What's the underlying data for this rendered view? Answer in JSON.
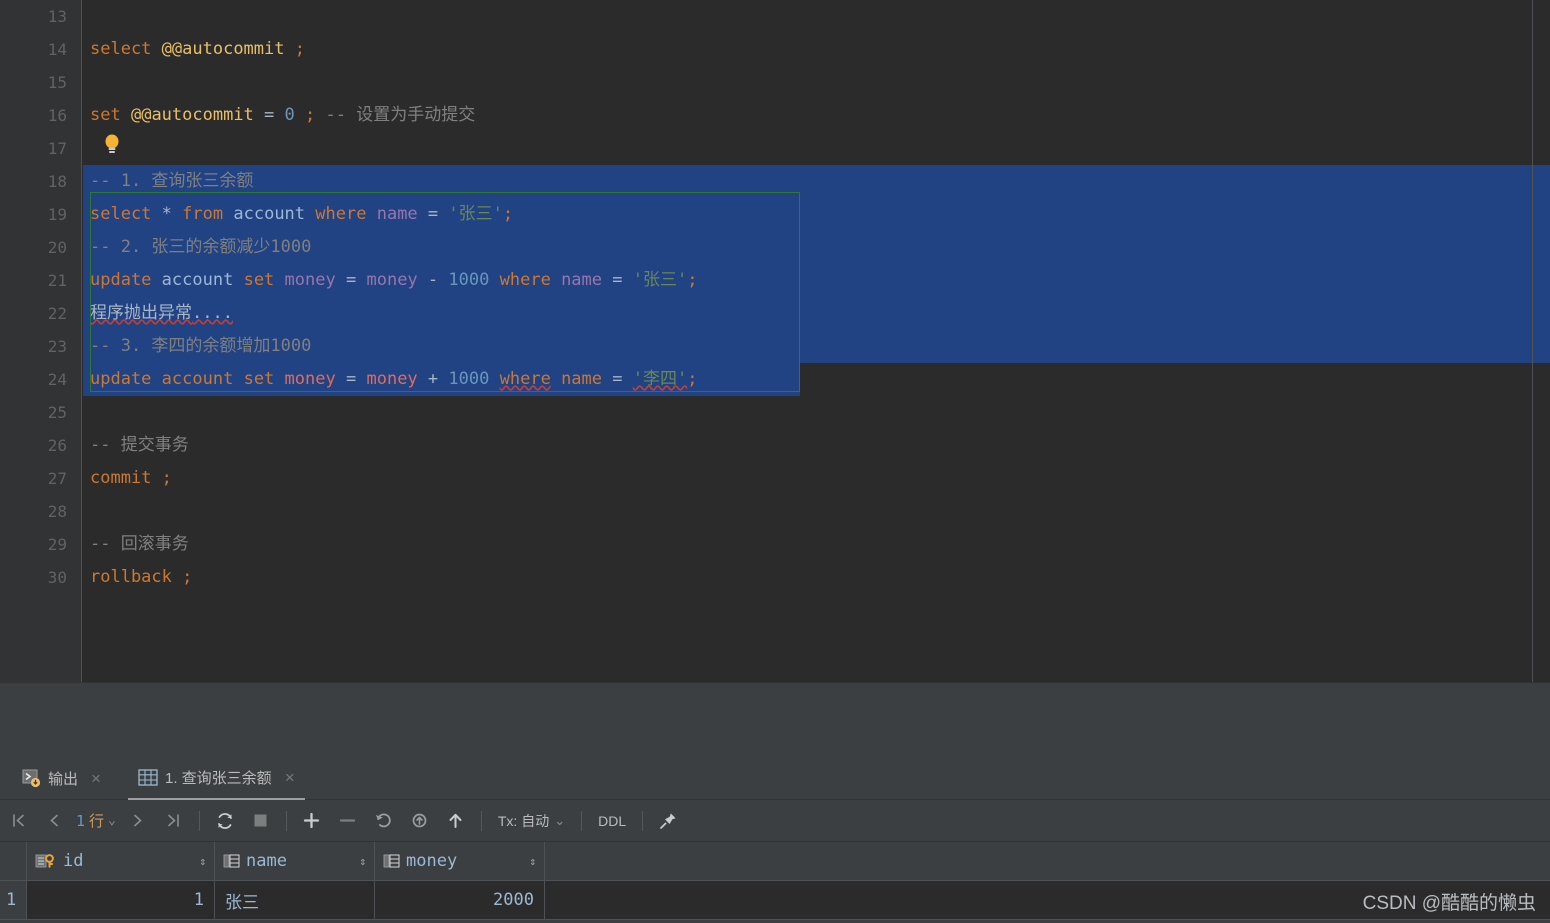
{
  "editor": {
    "first_line_number": 13,
    "lines": [
      {
        "num": 13,
        "selected": false,
        "tokens": []
      },
      {
        "num": 14,
        "selected": false,
        "tokens": [
          {
            "t": "select",
            "c": "kw"
          },
          {
            "t": " ",
            "c": "plain"
          },
          {
            "t": "@@autocommit",
            "c": "var"
          },
          {
            "t": " ",
            "c": "plain"
          },
          {
            "t": ";",
            "c": "kw"
          }
        ]
      },
      {
        "num": 15,
        "selected": false,
        "tokens": []
      },
      {
        "num": 16,
        "selected": false,
        "tokens": [
          {
            "t": "set",
            "c": "kw"
          },
          {
            "t": " ",
            "c": "plain"
          },
          {
            "t": "@@autocommit",
            "c": "var"
          },
          {
            "t": " ",
            "c": "plain"
          },
          {
            "t": "=",
            "c": "op"
          },
          {
            "t": " ",
            "c": "plain"
          },
          {
            "t": "0",
            "c": "num"
          },
          {
            "t": " ",
            "c": "plain"
          },
          {
            "t": ";",
            "c": "kw"
          },
          {
            "t": " ",
            "c": "plain"
          },
          {
            "t": "-- 设置为手动提交",
            "c": "cmt"
          }
        ]
      },
      {
        "num": 17,
        "selected": false,
        "tokens": []
      },
      {
        "num": 18,
        "selected": true,
        "tokens": [
          {
            "t": "-- 1. 查询张三余额",
            "c": "cmt"
          }
        ]
      },
      {
        "num": 19,
        "selected": true,
        "tokens": [
          {
            "t": "select",
            "c": "kw"
          },
          {
            "t": " ",
            "c": "plain"
          },
          {
            "t": "*",
            "c": "op"
          },
          {
            "t": " ",
            "c": "plain"
          },
          {
            "t": "from",
            "c": "kw"
          },
          {
            "t": " ",
            "c": "plain"
          },
          {
            "t": "account",
            "c": "tbl"
          },
          {
            "t": " ",
            "c": "plain"
          },
          {
            "t": "where",
            "c": "kw"
          },
          {
            "t": " ",
            "c": "plain"
          },
          {
            "t": "name",
            "c": "col"
          },
          {
            "t": " ",
            "c": "plain"
          },
          {
            "t": "=",
            "c": "op"
          },
          {
            "t": " ",
            "c": "plain"
          },
          {
            "t": "'张三'",
            "c": "str"
          },
          {
            "t": ";",
            "c": "kw"
          }
        ]
      },
      {
        "num": 20,
        "selected": true,
        "tokens": [
          {
            "t": "-- 2. 张三的余额减少1000",
            "c": "cmt"
          }
        ]
      },
      {
        "num": 21,
        "selected": true,
        "tokens": [
          {
            "t": "update",
            "c": "kw"
          },
          {
            "t": " ",
            "c": "plain"
          },
          {
            "t": "account",
            "c": "tbl"
          },
          {
            "t": " ",
            "c": "plain"
          },
          {
            "t": "set",
            "c": "kw"
          },
          {
            "t": " ",
            "c": "plain"
          },
          {
            "t": "money",
            "c": "col"
          },
          {
            "t": " ",
            "c": "plain"
          },
          {
            "t": "=",
            "c": "op"
          },
          {
            "t": " ",
            "c": "plain"
          },
          {
            "t": "money",
            "c": "col"
          },
          {
            "t": " ",
            "c": "plain"
          },
          {
            "t": "-",
            "c": "op"
          },
          {
            "t": " ",
            "c": "plain"
          },
          {
            "t": "1000",
            "c": "num"
          },
          {
            "t": " ",
            "c": "plain"
          },
          {
            "t": "where",
            "c": "kw"
          },
          {
            "t": " ",
            "c": "plain"
          },
          {
            "t": "name",
            "c": "col"
          },
          {
            "t": " ",
            "c": "plain"
          },
          {
            "t": "=",
            "c": "op"
          },
          {
            "t": " ",
            "c": "plain"
          },
          {
            "t": "'张三'",
            "c": "str"
          },
          {
            "t": ";",
            "c": "kw"
          }
        ]
      },
      {
        "num": 22,
        "selected": true,
        "tokens": [
          {
            "t": "程序抛出异常",
            "c": "plain sq"
          },
          {
            "t": "....",
            "c": "plain sq"
          }
        ]
      },
      {
        "num": 23,
        "selected": true,
        "tokens": [
          {
            "t": "-- 3. 李四的余额增加1000",
            "c": "cmt"
          }
        ]
      },
      {
        "num": 24,
        "selected": true,
        "tokens": [
          {
            "t": "update",
            "c": "kw"
          },
          {
            "t": " ",
            "c": "plain"
          },
          {
            "t": "account",
            "c": "kw"
          },
          {
            "t": " ",
            "c": "plain"
          },
          {
            "t": "set",
            "c": "kw"
          },
          {
            "t": " ",
            "c": "plain"
          },
          {
            "t": "money",
            "c": "colr"
          },
          {
            "t": " ",
            "c": "plain"
          },
          {
            "t": "=",
            "c": "op"
          },
          {
            "t": " ",
            "c": "plain"
          },
          {
            "t": "money",
            "c": "colr"
          },
          {
            "t": " ",
            "c": "plain"
          },
          {
            "t": "+",
            "c": "op"
          },
          {
            "t": " ",
            "c": "plain"
          },
          {
            "t": "1000",
            "c": "num"
          },
          {
            "t": " ",
            "c": "plain"
          },
          {
            "t": "where",
            "c": "kw sq"
          },
          {
            "t": " ",
            "c": "plain"
          },
          {
            "t": "name",
            "c": "kw"
          },
          {
            "t": " ",
            "c": "plain"
          },
          {
            "t": "=",
            "c": "op"
          },
          {
            "t": " ",
            "c": "plain"
          },
          {
            "t": "'李四'",
            "c": "str sq"
          },
          {
            "t": ";",
            "c": "kw"
          }
        ]
      },
      {
        "num": 25,
        "selected": false,
        "tokens": []
      },
      {
        "num": 26,
        "selected": false,
        "tokens": [
          {
            "t": "-- 提交事务",
            "c": "cmt"
          }
        ]
      },
      {
        "num": 27,
        "selected": false,
        "tokens": [
          {
            "t": "commit",
            "c": "kw"
          },
          {
            "t": " ",
            "c": "plain"
          },
          {
            "t": ";",
            "c": "kw"
          }
        ]
      },
      {
        "num": 28,
        "selected": false,
        "tokens": []
      },
      {
        "num": 29,
        "selected": false,
        "tokens": [
          {
            "t": "-- 回滚事务",
            "c": "cmt"
          }
        ]
      },
      {
        "num": 30,
        "selected": false,
        "tokens": [
          {
            "t": "rollback",
            "c": "kw"
          },
          {
            "t": " ",
            "c": "plain"
          },
          {
            "t": ";",
            "c": "kw"
          }
        ]
      }
    ],
    "intention_bulb": "lightbulb-icon",
    "colors": {
      "background": "#2B2B2B",
      "gutter": "#313335",
      "selection": "#214283",
      "green_outline": "#2F7A33",
      "keyword": "#CC7832",
      "string": "#6A8759",
      "number": "#6897BB",
      "comment": "#808080",
      "column": "#9876AA",
      "table": "#9BB8D4",
      "error_underline": "#BC3F3C"
    }
  },
  "result_panel": {
    "tabs": [
      {
        "label": "输出",
        "icon": "console-output-icon",
        "active": false,
        "close": "×"
      },
      {
        "label": "1. 查询张三余额",
        "icon": "table-grid-icon",
        "active": true,
        "close": "×"
      }
    ],
    "toolbar": {
      "first_page": "first-page-icon",
      "prev_page": "prev-page-icon",
      "row_count_number": "1",
      "row_count_unit": "行",
      "row_count_chevron": "⌄",
      "next_page": "next-page-icon",
      "last_page": "last-page-icon",
      "reload": "reload-icon",
      "stop": "stop-icon",
      "add_row": "add-row-icon",
      "delete_row": "delete-row-icon",
      "revert": "revert-icon",
      "revert_selected": "revert-selected-icon",
      "submit": "submit-icon",
      "tx_label": "Tx: 自动",
      "tx_chevron": "⌄",
      "ddl_label": "DDL",
      "pin": "pin-icon"
    },
    "grid": {
      "columns": [
        {
          "name": "id",
          "icon": "primary-key-icon",
          "sort": "⇕"
        },
        {
          "name": "name",
          "icon": "column-icon",
          "sort": "⇕"
        },
        {
          "name": "money",
          "icon": "column-icon",
          "sort": "⇕"
        }
      ],
      "rows": [
        {
          "index": "1",
          "id": "1",
          "name": "张三",
          "money": "2000"
        }
      ]
    }
  },
  "watermark": {
    "text": "CSDN @酷酷的懒虫"
  }
}
